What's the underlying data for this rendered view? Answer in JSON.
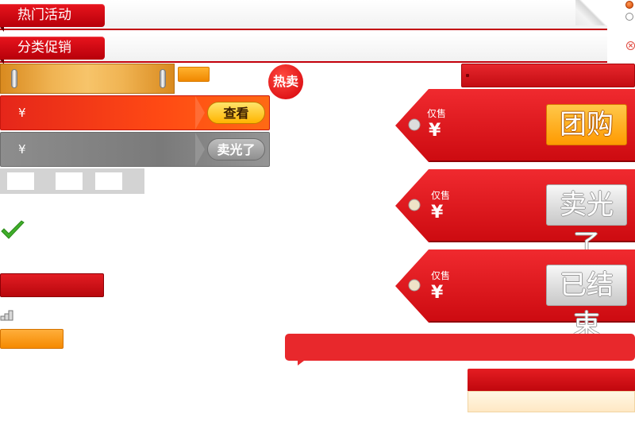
{
  "headers": {
    "hot_activities": "热门活动",
    "category_promo": "分类促销"
  },
  "badges": {
    "hot_sale": "热卖"
  },
  "price_bars": {
    "active": {
      "currency": "¥",
      "button": "查看"
    },
    "soldout": {
      "currency": "¥",
      "button": "卖光了"
    }
  },
  "tags": [
    {
      "label": "仅售",
      "currency": "¥",
      "button": "团购",
      "state": "active"
    },
    {
      "label": "仅售",
      "currency": "¥",
      "button": "卖光了",
      "state": "soldout"
    },
    {
      "label": "仅售",
      "currency": "¥",
      "button": "已结束",
      "state": "ended"
    }
  ],
  "radios": {
    "first_selected": true,
    "second_selected": false
  },
  "colors": {
    "brand_red": "#d8000b",
    "accent_orange": "#ff9a00",
    "grey": "#8a8a8a",
    "cream": "#fff1d6"
  },
  "icons": [
    "radio-on-icon",
    "radio-off-icon",
    "close-icon",
    "checkmark-icon",
    "coin-stack-icon"
  ]
}
